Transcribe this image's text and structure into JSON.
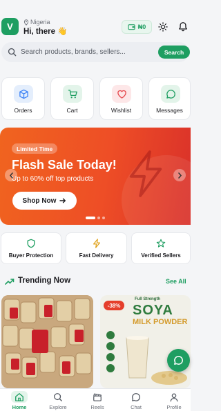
{
  "header": {
    "avatar_initial": "V",
    "location": "Nigeria",
    "greeting": "Hi, there 👋",
    "wallet_balance": "₦0"
  },
  "search": {
    "placeholder": "Search products, brands, sellers...",
    "button_label": "Search"
  },
  "quick_actions": [
    {
      "label": "Orders",
      "icon": "box-icon",
      "color": "#3b82f6"
    },
    {
      "label": "Cart",
      "icon": "cart-icon",
      "color": "#1e9e61"
    },
    {
      "label": "Wishlist",
      "icon": "heart-icon",
      "color": "#e5484d"
    },
    {
      "label": "Messages",
      "icon": "chat-bubble-icon",
      "color": "#1e9e61"
    }
  ],
  "banner": {
    "badge": "Limited Time",
    "title": "Flash Sale Today!",
    "subtitle": "Up to 60% off top products",
    "cta": "Shop Now",
    "slide_count": 3,
    "active_slide": 0
  },
  "features": [
    {
      "label": "Buyer Protection",
      "icon": "shield-icon",
      "color": "#1e9e61"
    },
    {
      "label": "Fast Delivery",
      "icon": "lightning-icon",
      "color": "#e0a21a"
    },
    {
      "label": "Verified Sellers",
      "icon": "star-icon",
      "color": "#1e9e61"
    }
  ],
  "trending": {
    "title": "Trending Now",
    "see_all": "See All"
  },
  "products": [
    {
      "image": "packaged-snacks-image"
    },
    {
      "discount": "-38%",
      "brand_tag": "Full Strength",
      "name_line1": "SOYA",
      "name_line2": "MILK POWDER"
    }
  ],
  "tabs": [
    {
      "label": "Home",
      "icon": "home-icon",
      "active": true
    },
    {
      "label": "Explore",
      "icon": "search-icon",
      "active": false
    },
    {
      "label": "Reels",
      "icon": "clapperboard-icon",
      "active": false
    },
    {
      "label": "Chat",
      "icon": "chat-bubble-icon",
      "active": false
    },
    {
      "label": "Profile",
      "icon": "user-icon",
      "active": false
    }
  ],
  "colors": {
    "brand_green": "#1e9e61",
    "banner_orange": "#f0641f",
    "banner_red": "#d9302a"
  }
}
